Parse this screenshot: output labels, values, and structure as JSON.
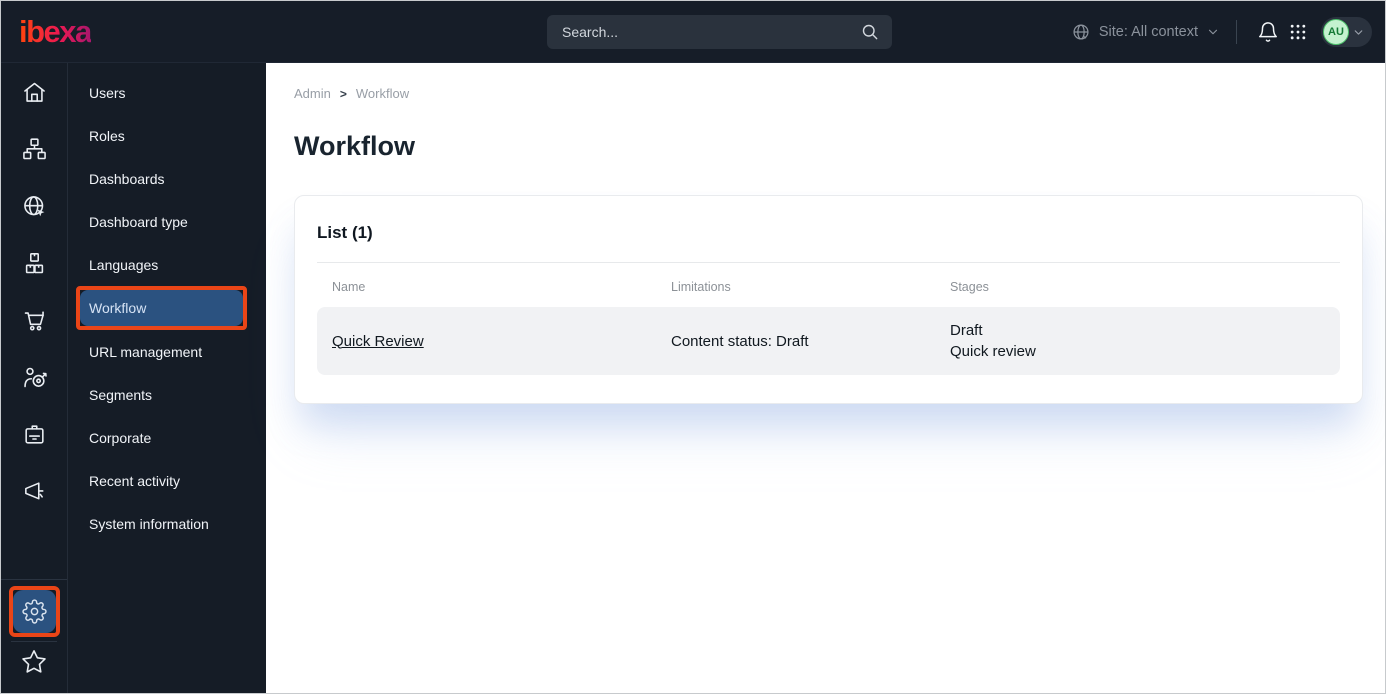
{
  "topbar": {
    "logo_text": "ibexa",
    "search": {
      "placeholder": "Search..."
    },
    "site_selector": {
      "label": "Site: All context"
    },
    "avatar": {
      "initials": "AU"
    }
  },
  "icons": {
    "rail": [
      "home",
      "sitemap",
      "site-globe",
      "products",
      "cart",
      "personalization",
      "member-badge",
      "campaign",
      "settings-gear",
      "bookmarks-star"
    ],
    "topbar": [
      "globe",
      "chevron-down",
      "bell",
      "app-grid",
      "search"
    ]
  },
  "sidebar": {
    "menu_items": [
      {
        "label": "Users",
        "active": false
      },
      {
        "label": "Roles",
        "active": false
      },
      {
        "label": "Dashboards",
        "active": false
      },
      {
        "label": "Dashboard type",
        "active": false
      },
      {
        "label": "Languages",
        "active": false
      },
      {
        "label": "Workflow",
        "active": true
      },
      {
        "label": "URL management",
        "active": false
      },
      {
        "label": "Segments",
        "active": false
      },
      {
        "label": "Corporate",
        "active": false
      },
      {
        "label": "Recent activity",
        "active": false
      },
      {
        "label": "System information",
        "active": false
      }
    ]
  },
  "main": {
    "breadcrumb": {
      "items": [
        "Admin",
        "Workflow"
      ],
      "separator": ">"
    },
    "page_title": "Workflow",
    "list_card": {
      "heading": "List (1)",
      "columns": [
        "Name",
        "Limitations",
        "Stages"
      ],
      "rows": [
        {
          "name": "Quick Review",
          "limitations": "Content status: Draft",
          "stages": [
            "Draft",
            "Quick review"
          ]
        }
      ]
    }
  },
  "colors": {
    "topbar_bg": "#161d28",
    "sidebar_bg": "#151c26",
    "active_item_bg": "#2b5280",
    "annotation_highlight": "#ea4517",
    "avatar_bg": "#c4f2cf",
    "avatar_text": "#147a35",
    "logo_gradient_start": "#ff4113",
    "logo_gradient_end": "#a9176d",
    "row_bg": "#f1f2f4"
  }
}
